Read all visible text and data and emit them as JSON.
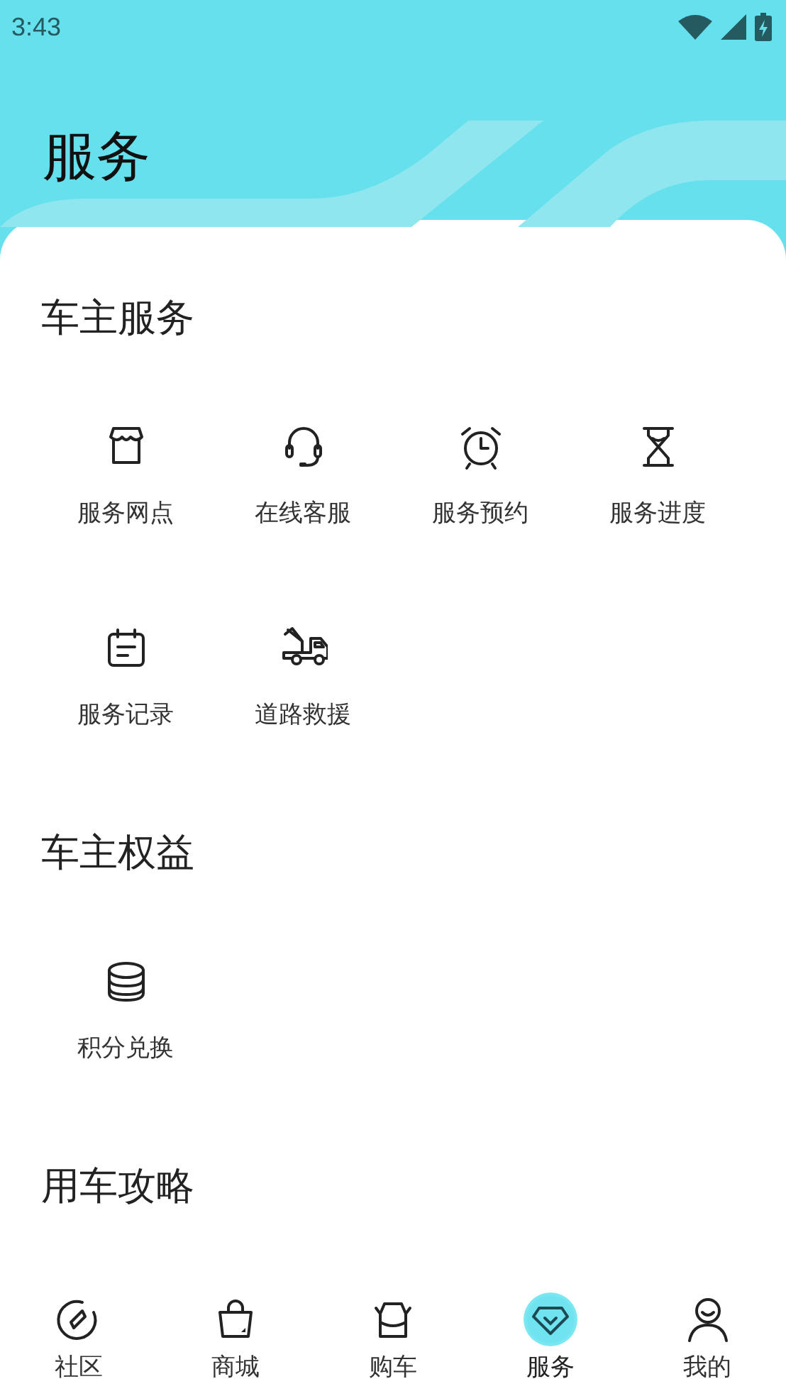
{
  "status_bar": {
    "time": "3:43"
  },
  "header": {
    "title": "服务"
  },
  "sections": [
    {
      "title": "车主服务",
      "items": [
        {
          "label": "服务网点"
        },
        {
          "label": "在线客服"
        },
        {
          "label": "服务预约"
        },
        {
          "label": "服务进度"
        },
        {
          "label": "服务记录"
        },
        {
          "label": "道路救援"
        }
      ]
    },
    {
      "title": "车主权益",
      "items": [
        {
          "label": "积分兑换"
        }
      ]
    },
    {
      "title": "用车攻略"
    }
  ],
  "tabs": [
    {
      "label": "社区",
      "selected": false
    },
    {
      "label": "商城",
      "selected": false
    },
    {
      "label": "购车",
      "selected": false
    },
    {
      "label": "服务",
      "selected": true
    },
    {
      "label": "我的",
      "selected": false
    }
  ]
}
